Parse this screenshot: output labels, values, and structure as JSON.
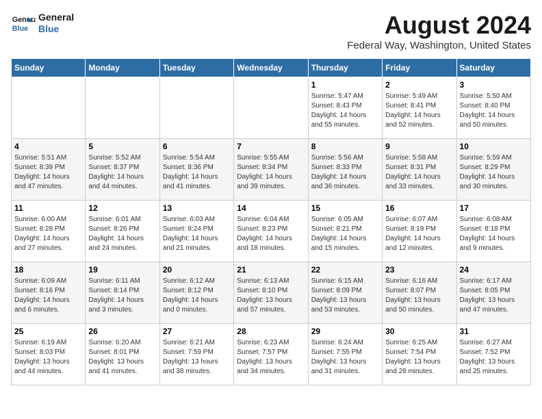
{
  "header": {
    "logo_line1": "General",
    "logo_line2": "Blue",
    "title": "August 2024",
    "subtitle": "Federal Way, Washington, United States"
  },
  "calendar": {
    "weekdays": [
      "Sunday",
      "Monday",
      "Tuesday",
      "Wednesday",
      "Thursday",
      "Friday",
      "Saturday"
    ],
    "weeks": [
      [
        {
          "day": "",
          "info": ""
        },
        {
          "day": "",
          "info": ""
        },
        {
          "day": "",
          "info": ""
        },
        {
          "day": "",
          "info": ""
        },
        {
          "day": "1",
          "info": "Sunrise: 5:47 AM\nSunset: 8:43 PM\nDaylight: 14 hours\nand 55 minutes."
        },
        {
          "day": "2",
          "info": "Sunrise: 5:49 AM\nSunset: 8:41 PM\nDaylight: 14 hours\nand 52 minutes."
        },
        {
          "day": "3",
          "info": "Sunrise: 5:50 AM\nSunset: 8:40 PM\nDaylight: 14 hours\nand 50 minutes."
        }
      ],
      [
        {
          "day": "4",
          "info": "Sunrise: 5:51 AM\nSunset: 8:39 PM\nDaylight: 14 hours\nand 47 minutes."
        },
        {
          "day": "5",
          "info": "Sunrise: 5:52 AM\nSunset: 8:37 PM\nDaylight: 14 hours\nand 44 minutes."
        },
        {
          "day": "6",
          "info": "Sunrise: 5:54 AM\nSunset: 8:36 PM\nDaylight: 14 hours\nand 41 minutes."
        },
        {
          "day": "7",
          "info": "Sunrise: 5:55 AM\nSunset: 8:34 PM\nDaylight: 14 hours\nand 39 minutes."
        },
        {
          "day": "8",
          "info": "Sunrise: 5:56 AM\nSunset: 8:33 PM\nDaylight: 14 hours\nand 36 minutes."
        },
        {
          "day": "9",
          "info": "Sunrise: 5:58 AM\nSunset: 8:31 PM\nDaylight: 14 hours\nand 33 minutes."
        },
        {
          "day": "10",
          "info": "Sunrise: 5:59 AM\nSunset: 8:29 PM\nDaylight: 14 hours\nand 30 minutes."
        }
      ],
      [
        {
          "day": "11",
          "info": "Sunrise: 6:00 AM\nSunset: 8:28 PM\nDaylight: 14 hours\nand 27 minutes."
        },
        {
          "day": "12",
          "info": "Sunrise: 6:01 AM\nSunset: 8:26 PM\nDaylight: 14 hours\nand 24 minutes."
        },
        {
          "day": "13",
          "info": "Sunrise: 6:03 AM\nSunset: 8:24 PM\nDaylight: 14 hours\nand 21 minutes."
        },
        {
          "day": "14",
          "info": "Sunrise: 6:04 AM\nSunset: 8:23 PM\nDaylight: 14 hours\nand 18 minutes."
        },
        {
          "day": "15",
          "info": "Sunrise: 6:05 AM\nSunset: 8:21 PM\nDaylight: 14 hours\nand 15 minutes."
        },
        {
          "day": "16",
          "info": "Sunrise: 6:07 AM\nSunset: 8:19 PM\nDaylight: 14 hours\nand 12 minutes."
        },
        {
          "day": "17",
          "info": "Sunrise: 6:08 AM\nSunset: 8:18 PM\nDaylight: 14 hours\nand 9 minutes."
        }
      ],
      [
        {
          "day": "18",
          "info": "Sunrise: 6:09 AM\nSunset: 8:16 PM\nDaylight: 14 hours\nand 6 minutes."
        },
        {
          "day": "19",
          "info": "Sunrise: 6:11 AM\nSunset: 8:14 PM\nDaylight: 14 hours\nand 3 minutes."
        },
        {
          "day": "20",
          "info": "Sunrise: 6:12 AM\nSunset: 8:12 PM\nDaylight: 14 hours\nand 0 minutes."
        },
        {
          "day": "21",
          "info": "Sunrise: 6:13 AM\nSunset: 8:10 PM\nDaylight: 13 hours\nand 57 minutes."
        },
        {
          "day": "22",
          "info": "Sunrise: 6:15 AM\nSunset: 8:09 PM\nDaylight: 13 hours\nand 53 minutes."
        },
        {
          "day": "23",
          "info": "Sunrise: 6:16 AM\nSunset: 8:07 PM\nDaylight: 13 hours\nand 50 minutes."
        },
        {
          "day": "24",
          "info": "Sunrise: 6:17 AM\nSunset: 8:05 PM\nDaylight: 13 hours\nand 47 minutes."
        }
      ],
      [
        {
          "day": "25",
          "info": "Sunrise: 6:19 AM\nSunset: 8:03 PM\nDaylight: 13 hours\nand 44 minutes."
        },
        {
          "day": "26",
          "info": "Sunrise: 6:20 AM\nSunset: 8:01 PM\nDaylight: 13 hours\nand 41 minutes."
        },
        {
          "day": "27",
          "info": "Sunrise: 6:21 AM\nSunset: 7:59 PM\nDaylight: 13 hours\nand 38 minutes."
        },
        {
          "day": "28",
          "info": "Sunrise: 6:23 AM\nSunset: 7:57 PM\nDaylight: 13 hours\nand 34 minutes."
        },
        {
          "day": "29",
          "info": "Sunrise: 6:24 AM\nSunset: 7:55 PM\nDaylight: 13 hours\nand 31 minutes."
        },
        {
          "day": "30",
          "info": "Sunrise: 6:25 AM\nSunset: 7:54 PM\nDaylight: 13 hours\nand 28 minutes."
        },
        {
          "day": "31",
          "info": "Sunrise: 6:27 AM\nSunset: 7:52 PM\nDaylight: 13 hours\nand 25 minutes."
        }
      ]
    ]
  }
}
